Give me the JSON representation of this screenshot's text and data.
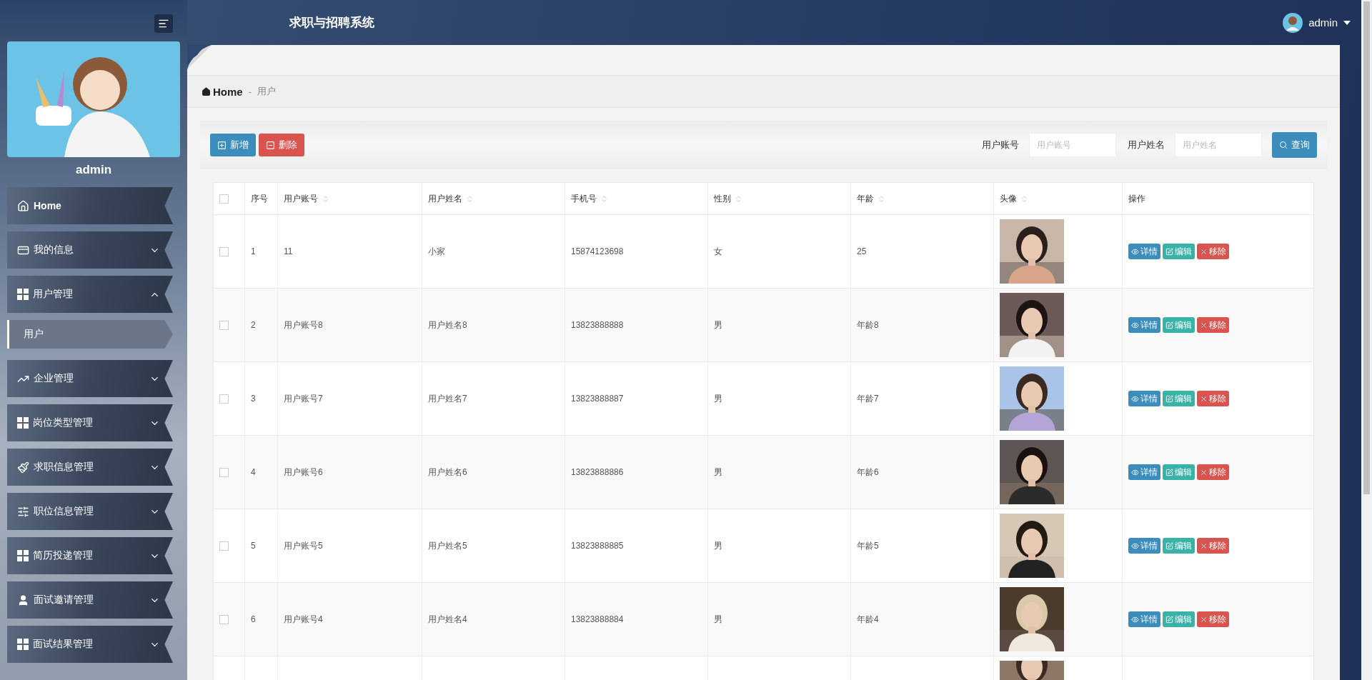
{
  "header": {
    "title": "求职与招聘系统",
    "user": "admin"
  },
  "sidebar": {
    "user_name": "admin",
    "menu": [
      {
        "label": "Home"
      },
      {
        "label": "我的信息",
        "expanded": false
      },
      {
        "label": "用户管理",
        "expanded": true,
        "children": [
          {
            "label": "用户",
            "selected": true
          }
        ]
      },
      {
        "label": "企业管理",
        "expanded": false
      },
      {
        "label": "岗位类型管理",
        "expanded": false
      },
      {
        "label": "求职信息管理",
        "expanded": false
      },
      {
        "label": "职位信息管理",
        "expanded": false
      },
      {
        "label": "简历投递管理",
        "expanded": false
      },
      {
        "label": "面试邀请管理",
        "expanded": false
      },
      {
        "label": "面试结果管理",
        "expanded": false
      }
    ]
  },
  "breadcrumb": {
    "home": "Home",
    "separator": "-",
    "current": "用户"
  },
  "toolbar": {
    "buttons": [
      {
        "label": "新增",
        "kind": "add"
      },
      {
        "label": "删除",
        "kind": "delete"
      }
    ],
    "search": [
      {
        "label": "用户账号",
        "placeholder": "用户账号"
      },
      {
        "label": "用户姓名",
        "placeholder": "用户姓名"
      }
    ],
    "search_button": "查询"
  },
  "table": {
    "select_all_checked": false,
    "columns": [
      {
        "label": "序号",
        "sortable": false
      },
      {
        "label": "用户账号",
        "sortable": true
      },
      {
        "label": "用户姓名",
        "sortable": true
      },
      {
        "label": "手机号",
        "sortable": true
      },
      {
        "label": "性别",
        "sortable": true
      },
      {
        "label": "年龄",
        "sortable": true
      },
      {
        "label": "头像",
        "sortable": true
      },
      {
        "label": "操作",
        "sortable": false
      }
    ],
    "rows": [
      {
        "kind": "full",
        "checked": false,
        "cells": [
          "1",
          "11",
          "小家",
          "15874123698",
          "女",
          "25"
        ],
        "actions": [
          {
            "label": "详情",
            "kind": "view"
          },
          {
            "label": "编辑",
            "kind": "edit"
          },
          {
            "label": "移除",
            "kind": "remove"
          }
        ]
      },
      {
        "kind": "full",
        "checked": false,
        "cells": [
          "2",
          "用户账号8",
          "用户姓名8",
          "13823888888",
          "男",
          "年龄8"
        ],
        "actions": [
          {
            "label": "详情",
            "kind": "view"
          },
          {
            "label": "编辑",
            "kind": "edit"
          },
          {
            "label": "移除",
            "kind": "remove"
          }
        ]
      },
      {
        "kind": "full",
        "checked": false,
        "cells": [
          "3",
          "用户账号7",
          "用户姓名7",
          "13823888887",
          "男",
          "年龄7"
        ],
        "actions": [
          {
            "label": "详情",
            "kind": "view"
          },
          {
            "label": "编辑",
            "kind": "edit"
          },
          {
            "label": "移除",
            "kind": "remove"
          }
        ]
      },
      {
        "kind": "full",
        "checked": false,
        "cells": [
          "4",
          "用户账号6",
          "用户姓名6",
          "13823888886",
          "男",
          "年龄6"
        ],
        "actions": [
          {
            "label": "详情",
            "kind": "view"
          },
          {
            "label": "编辑",
            "kind": "edit"
          },
          {
            "label": "移除",
            "kind": "remove"
          }
        ]
      },
      {
        "kind": "full",
        "checked": false,
        "cells": [
          "5",
          "用户账号5",
          "用户姓名5",
          "13823888885",
          "男",
          "年龄5"
        ],
        "actions": [
          {
            "label": "详情",
            "kind": "view"
          },
          {
            "label": "编辑",
            "kind": "edit"
          },
          {
            "label": "移除",
            "kind": "remove"
          }
        ]
      },
      {
        "kind": "full",
        "checked": false,
        "cells": [
          "6",
          "用户账号4",
          "用户姓名4",
          "13823888884",
          "男",
          "年龄4"
        ],
        "actions": [
          {
            "label": "详情",
            "kind": "view"
          },
          {
            "label": "编辑",
            "kind": "edit"
          },
          {
            "label": "移除",
            "kind": "remove"
          }
        ]
      },
      {
        "kind": "partial"
      }
    ]
  }
}
